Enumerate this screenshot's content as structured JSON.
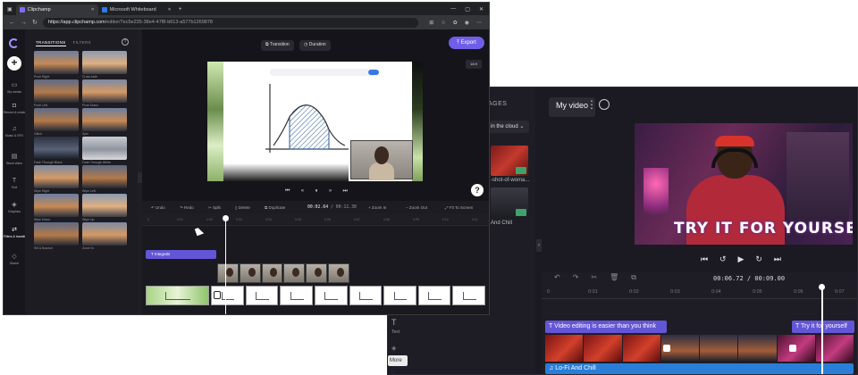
{
  "front": {
    "tabs": [
      {
        "label": "Clipchamp",
        "active": true
      },
      {
        "label": "Microsoft Whiteboard",
        "active": false
      }
    ],
    "url_host": "https://app.clipchamp.com",
    "url_path": "/editor/7ec5e235-38e4-47f8-b613-a577b1269878",
    "rail": [
      {
        "icon": "folder-icon",
        "glyph": "▭",
        "label": "My media"
      },
      {
        "icon": "record-icon",
        "glyph": "◘",
        "label": "Record & create"
      },
      {
        "icon": "music-icon",
        "glyph": "♫",
        "label": "Music & SFX"
      },
      {
        "icon": "stock-icon",
        "glyph": "▤",
        "label": "Stock video"
      },
      {
        "icon": "text-icon",
        "glyph": "T",
        "label": "Text"
      },
      {
        "icon": "graphics-icon",
        "glyph": "◈",
        "label": "Graphics"
      },
      {
        "icon": "transitions-icon",
        "glyph": "⇄",
        "label": "Filters & transitions"
      },
      {
        "icon": "brand-icon",
        "glyph": "◇",
        "label": "Brand"
      }
    ],
    "panel_tabs": [
      "TRANSITIONS",
      "FILTERS"
    ],
    "transitions": [
      {
        "label": "Push Right",
        "tone": "t0"
      },
      {
        "label": "Cross fade",
        "tone": "t1"
      },
      {
        "label": "Push Left",
        "tone": "t2"
      },
      {
        "label": "Push Down",
        "tone": "t3"
      },
      {
        "label": "Glitch",
        "tone": "t2"
      },
      {
        "label": "Spin",
        "tone": "t0"
      },
      {
        "label": "Fade Through Black",
        "tone": "t4"
      },
      {
        "label": "Fade Through White",
        "tone": "t5"
      },
      {
        "label": "Wipe Right",
        "tone": "t3"
      },
      {
        "label": "Wipe Left",
        "tone": "t2"
      },
      {
        "label": "Wipe Down",
        "tone": "t0"
      },
      {
        "label": "Wipe Up",
        "tone": "t1"
      },
      {
        "label": "Slit & Bounce",
        "tone": "t2"
      },
      {
        "label": "Zoom In",
        "tone": "t3"
      }
    ],
    "top_buttons": {
      "transition": "Transition",
      "duration": "Duration"
    },
    "export_label": "Export",
    "ratio": "16:9",
    "player": {
      "glyphs": [
        "⏮",
        "«",
        "⏸",
        "»",
        "⏭"
      ]
    },
    "toolbar": {
      "undo": "Undo",
      "redo": "Redo",
      "split": "Split",
      "delete": "Delete",
      "duplicate": "Duplicate",
      "time_current": "00:02.64",
      "time_total": "/ 00:11.30",
      "zoom_in": "Zoom In",
      "zoom_out": "Zoom Out",
      "fit": "Fit To Screen"
    },
    "ruler": [
      "0",
      "0:01",
      "0:02",
      "0:03",
      "0:04",
      "0:05",
      "0:06",
      "0:07",
      "0:08",
      "0:09",
      "0:10",
      "0:11"
    ],
    "text_clip": "Integrals",
    "help": "?"
  },
  "back": {
    "project_title": "My video",
    "media_header": "AGES",
    "cloud_filter": "in the cloud ⌄",
    "media": [
      {
        "caption": "-shot-of-woma..."
      },
      {
        "caption": "And Chill"
      }
    ],
    "preview_caption": "TRY IT FOR YOURSELF",
    "player": {
      "glyphs": [
        "⏮",
        "↺",
        "▶",
        "↻",
        "⏭"
      ]
    },
    "time": "00:06.72 / 00:09.00",
    "ruler": [
      "0",
      "0:01",
      "0:02",
      "0:03",
      "0:04",
      "0:05",
      "0:06",
      "0:07"
    ],
    "text_clips": [
      "T  Video editing is easier than you think",
      "T  Try it for yourself"
    ],
    "audio_clip": "♫  Lo-Fi And Chill",
    "rail_text": "Text",
    "more": "More ⌄"
  }
}
